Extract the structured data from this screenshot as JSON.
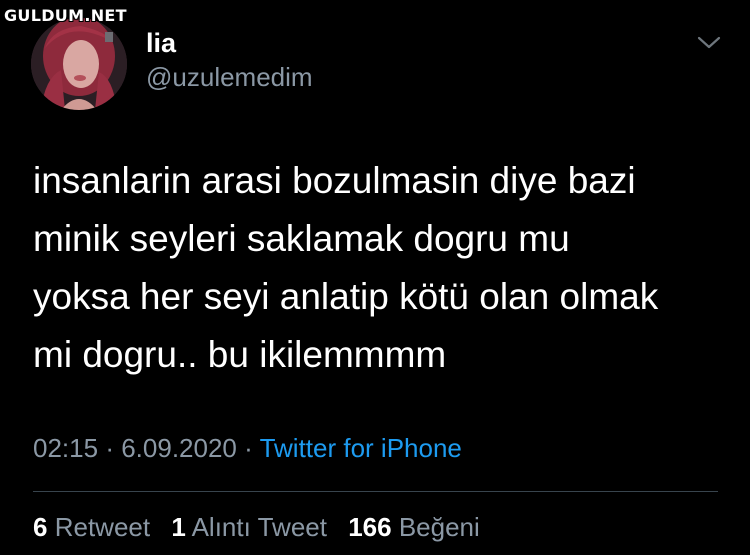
{
  "watermark": "GULDUM.NET",
  "user": {
    "display_name": "lia",
    "handle": "@uzulemedim"
  },
  "tweet": {
    "lines": [
      "insanlarin arasi bozulmasin diye bazi",
      "minik seyleri saklamak dogru mu",
      "yoksa her seyi anlatip kötü olan olmak",
      "mi dogru.. bu ikilemmmm"
    ]
  },
  "meta": {
    "time": "02:15",
    "separator": "·",
    "date": "6.09.2020",
    "source": "Twitter for iPhone"
  },
  "stats": {
    "retweets_count": "6",
    "retweets_label": "Retweet",
    "quotes_count": "1",
    "quotes_label": "Alıntı Tweet",
    "likes_count": "166",
    "likes_label": "Beğeni"
  },
  "icons": {
    "more": "chevron-down-icon"
  },
  "colors": {
    "background": "#000000",
    "secondary_text": "#8b98a5",
    "link": "#1d9bf0",
    "divider": "#38444d"
  }
}
